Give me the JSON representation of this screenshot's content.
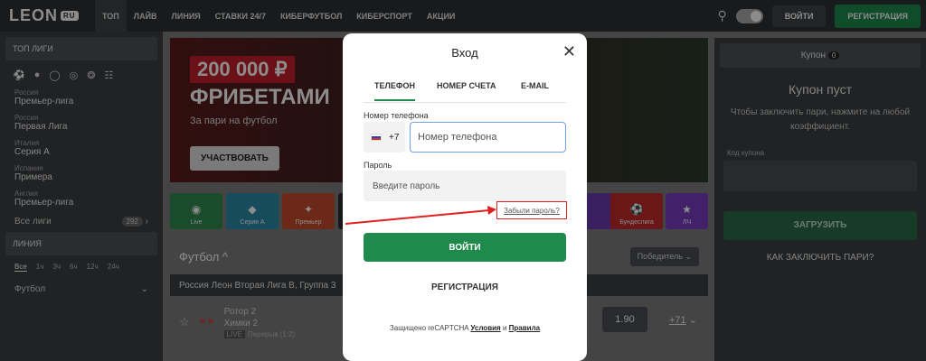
{
  "brand": {
    "logo": "LEON",
    "logo_badge": "RU"
  },
  "nav": {
    "items": [
      "ТОП",
      "ЛАЙВ",
      "ЛИНИЯ",
      "СТАВКИ 24/7",
      "КИБЕРФУТБОЛ",
      "КИБЕРСПОРТ",
      "АКЦИИ"
    ],
    "login": "ВОЙТИ",
    "register": "РЕГИСТРАЦИЯ"
  },
  "sidebar": {
    "top_header": "ТОП ЛИГИ",
    "leagues": [
      {
        "country": "Россия",
        "name": "Премьер-лига"
      },
      {
        "country": "Россия",
        "name": "Первая Лига"
      },
      {
        "country": "Италия",
        "name": "Серия А"
      },
      {
        "country": "Испания",
        "name": "Примера"
      },
      {
        "country": "Англия",
        "name": "Премьер-лига"
      }
    ],
    "all_leagues": "Все лиги",
    "all_count": "292",
    "line_header": "ЛИНИЯ",
    "periods": [
      "Все",
      "1ч",
      "3ч",
      "6ч",
      "12ч",
      "24ч"
    ],
    "football": "Футбол"
  },
  "banner": {
    "amount": "200 000 ₽",
    "title": "ФРИБЕТАМИ",
    "sub": "За пари на футбол",
    "cta": "УЧАСТВОВАТЬ"
  },
  "tiles": [
    "Live",
    "Серия А",
    "Премьер",
    "",
    "",
    "",
    "",
    "Бундеслига",
    "ЛЧ"
  ],
  "sport": {
    "title": "Футбол ^",
    "selector": "Победитель"
  },
  "competition": "Россия Леон Вторая Лига В, Группа 3",
  "match": {
    "team1": "Ротор 2",
    "team2": "Химки 2",
    "live": "LIVE",
    "period": "Перерыв (1:2)",
    "odd": "1.90",
    "more": "+71"
  },
  "coupon": {
    "header": "Купон",
    "count": "0",
    "title": "Купон пуст",
    "text": "Чтобы заключить пари, нажмите на любой коэффициент.",
    "code_label": "Код купона",
    "load": "ЗАГРУЗИТЬ",
    "how": "КАК ЗАКЛЮЧИТЬ ПАРИ?"
  },
  "modal": {
    "title": "Вход",
    "tabs": [
      "ТЕЛЕФОН",
      "НОМЕР СЧЕТА",
      "E-MAIL"
    ],
    "phone_label": "Номер телефона",
    "prefix": "+7",
    "phone_placeholder": "Номер телефона",
    "password_label": "Пароль",
    "password_placeholder": "Введите пароль",
    "forgot": "Забыли пароль?",
    "login": "ВОЙТИ",
    "register": "РЕГИСТРАЦИЯ",
    "recaptcha_text": "Защищено reCAPTCHA",
    "terms": "Условия",
    "and": "и",
    "rules": "Правила"
  },
  "colors": {
    "accent": "#1f8a4c",
    "highlight": "#e02020"
  }
}
